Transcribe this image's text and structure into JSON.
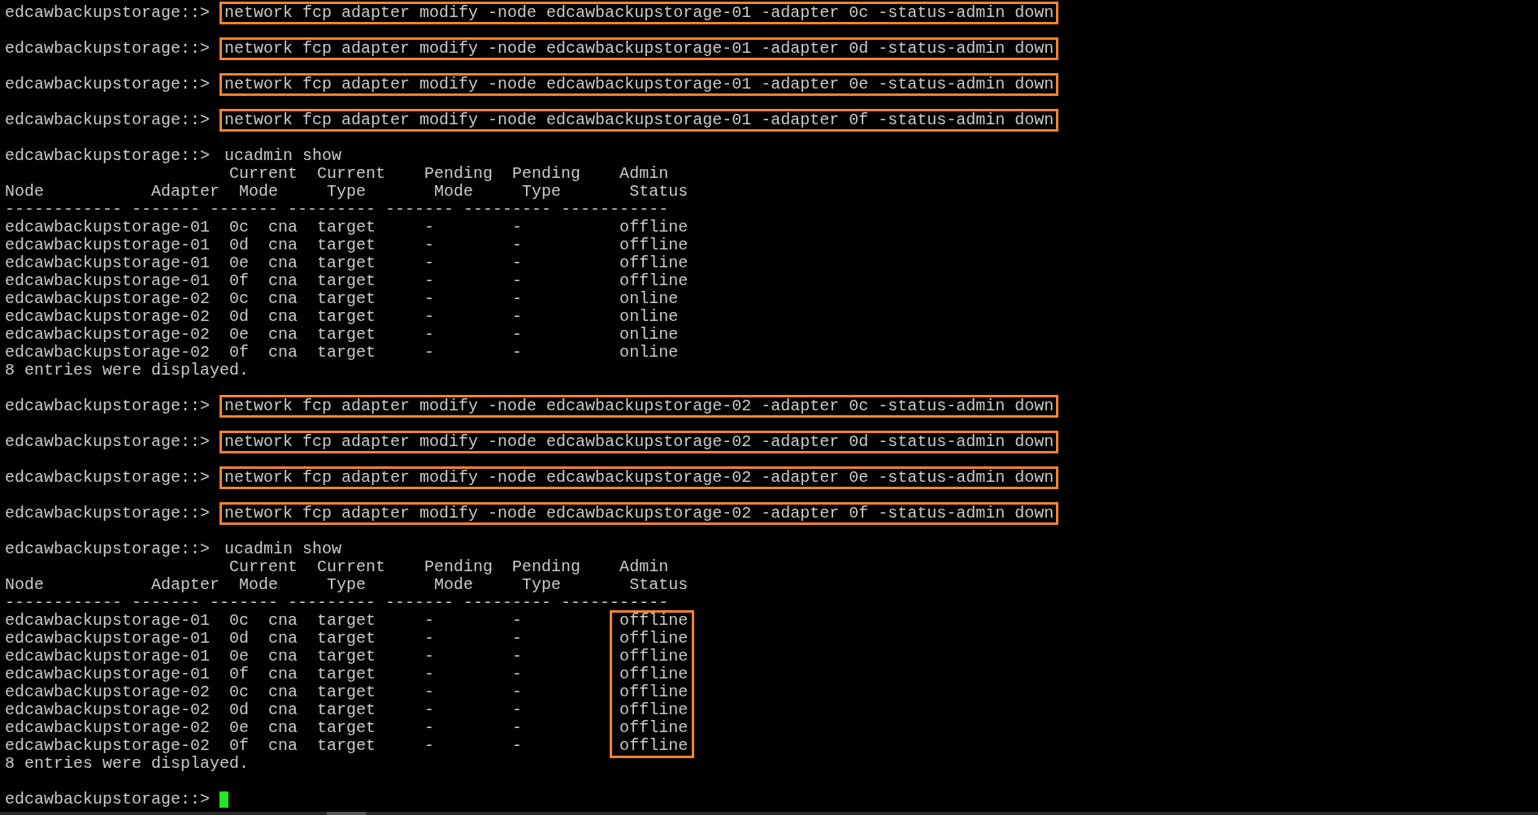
{
  "terminal": {
    "lines": [
      {
        "kind": "command",
        "prompt": "edcawbackupstorage::>",
        "command": "network fcp adapter modify -node edcawbackupstorage-01 -adapter 0c -status-admin down",
        "highlighted": true
      },
      {
        "kind": "command",
        "prompt": "edcawbackupstorage::>",
        "command": "network fcp adapter modify -node edcawbackupstorage-01 -adapter 0d -status-admin down",
        "highlighted": true
      },
      {
        "kind": "command",
        "prompt": "edcawbackupstorage::>",
        "command": "network fcp adapter modify -node edcawbackupstorage-01 -adapter 0e -status-admin down",
        "highlighted": true
      },
      {
        "kind": "command",
        "prompt": "edcawbackupstorage::>",
        "command": "network fcp adapter modify -node edcawbackupstorage-01 -adapter 0f -status-admin down",
        "highlighted": true
      },
      {
        "kind": "command",
        "prompt": "edcawbackupstorage::>",
        "command": "ucadmin show",
        "highlighted": false
      },
      {
        "kind": "output",
        "header": [
          "                       Current  Current    Pending  Pending    Admin",
          "Node           Adapter  Mode     Type       Mode     Type       Status",
          "------------ ------- ------- --------- ------- --------- -----------"
        ],
        "rows": [
          "edcawbackupstorage-01  0c  cna  target     -        -          offline",
          "edcawbackupstorage-01  0d  cna  target     -        -          offline",
          "edcawbackupstorage-01  0e  cna  target     -        -          offline",
          "edcawbackupstorage-01  0f  cna  target     -        -          offline",
          "edcawbackupstorage-02  0c  cna  target     -        -          online",
          "edcawbackupstorage-02  0d  cna  target     -        -          online",
          "edcawbackupstorage-02  0e  cna  target     -        -          online",
          "edcawbackupstorage-02  0f  cna  target     -        -          online"
        ],
        "footer": "8 entries were displayed."
      },
      {
        "kind": "command",
        "prompt": "edcawbackupstorage::>",
        "command": "network fcp adapter modify -node edcawbackupstorage-02 -adapter 0c -status-admin down",
        "highlighted": true
      },
      {
        "kind": "command",
        "prompt": "edcawbackupstorage::>",
        "command": "network fcp adapter modify -node edcawbackupstorage-02 -adapter 0d -status-admin down",
        "highlighted": true
      },
      {
        "kind": "command",
        "prompt": "edcawbackupstorage::>",
        "command": "network fcp adapter modify -node edcawbackupstorage-02 -adapter 0e -status-admin down",
        "highlighted": true
      },
      {
        "kind": "command",
        "prompt": "edcawbackupstorage::>",
        "command": "network fcp adapter modify -node edcawbackupstorage-02 -adapter 0f -status-admin down",
        "highlighted": true
      },
      {
        "kind": "command",
        "prompt": "edcawbackupstorage::>",
        "command": "ucadmin show",
        "highlighted": false
      },
      {
        "kind": "output",
        "status_highlighted": true,
        "header": [
          "                       Current  Current    Pending  Pending    Admin",
          "Node           Adapter  Mode     Type       Mode     Type       Status",
          "------------ ------- ------- --------- ------- --------- -----------"
        ],
        "rows": [
          "edcawbackupstorage-01  0c  cna  target     -        -          offline",
          "edcawbackupstorage-01  0d  cna  target     -        -          offline",
          "edcawbackupstorage-01  0e  cna  target     -        -          offline",
          "edcawbackupstorage-01  0f  cna  target     -        -          offline",
          "edcawbackupstorage-02  0c  cna  target     -        -          offline",
          "edcawbackupstorage-02  0d  cna  target     -        -          offline",
          "edcawbackupstorage-02  0e  cna  target     -        -          offline",
          "edcawbackupstorage-02  0f  cna  target     -        -          offline"
        ],
        "footer": "8 entries were displayed."
      },
      {
        "kind": "prompt",
        "prompt": "edcawbackupstorage::>",
        "cursor": true
      }
    ]
  }
}
